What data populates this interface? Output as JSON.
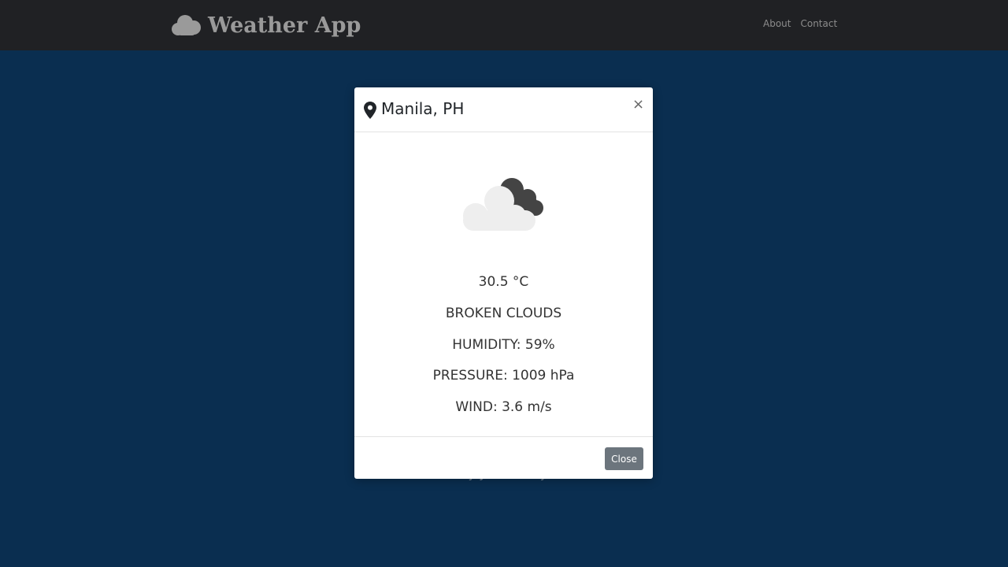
{
  "navbar": {
    "brand_title": "Weather App",
    "brand_icon": "cloud-icon",
    "links": [
      "About",
      "Contact"
    ]
  },
  "footer": {
    "credit": "Created by: John Anthony Bataller"
  },
  "modal": {
    "location_icon": "map-pin-icon",
    "title": "Manila, PH",
    "close_symbol": "×",
    "weather_icon": "broken-clouds-icon",
    "temperature": "30.5 °C",
    "description": "BROKEN CLOUDS",
    "humidity": "HUMIDITY: 59%",
    "pressure": "PRESSURE: 1009 hPa",
    "wind": "WIND: 3.6 m/s",
    "close_label": "Close"
  },
  "colors": {
    "page_background": "#0a2e50",
    "navbar_background": "#202124",
    "close_button": "#6c757d"
  }
}
